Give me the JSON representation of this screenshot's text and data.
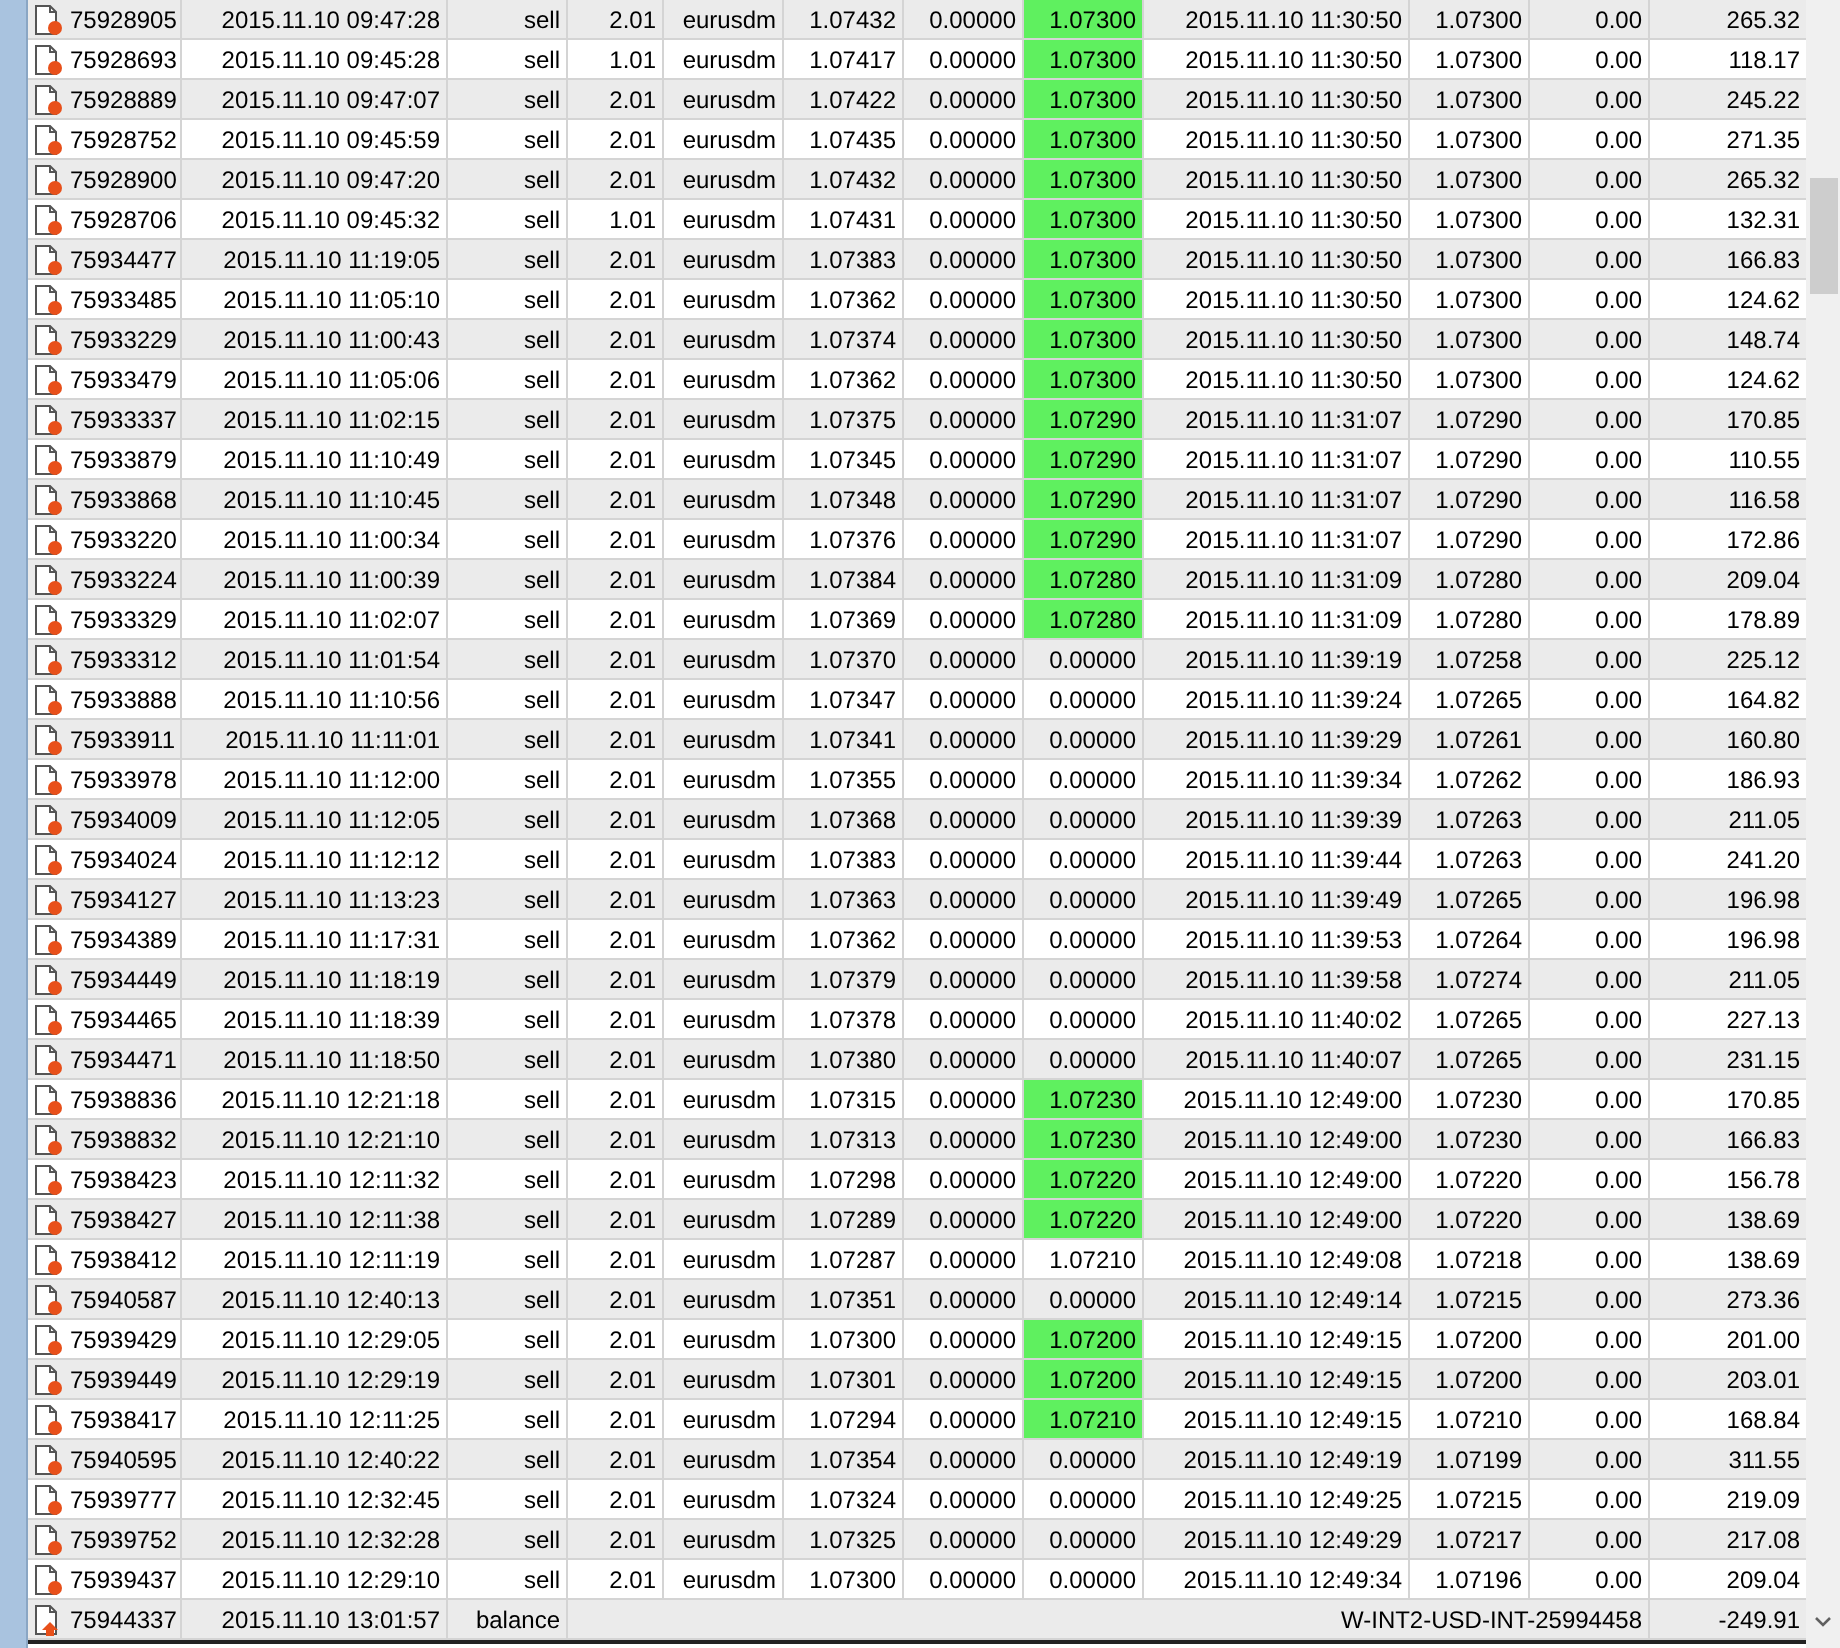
{
  "rows": [
    {
      "ticket": "75928905",
      "open_time": "2015.11.10 09:47:28",
      "type": "sell",
      "size": "2.01",
      "symbol": "eurusdm",
      "price": "1.07432",
      "sl": "0.00000",
      "tp": "1.07300",
      "tp_highlighted": true,
      "close_time": "2015.11.10 11:30:50",
      "close_price": "1.07300",
      "swap": "0.00",
      "profit": "265.32"
    },
    {
      "ticket": "75928693",
      "open_time": "2015.11.10 09:45:28",
      "type": "sell",
      "size": "1.01",
      "symbol": "eurusdm",
      "price": "1.07417",
      "sl": "0.00000",
      "tp": "1.07300",
      "tp_highlighted": true,
      "close_time": "2015.11.10 11:30:50",
      "close_price": "1.07300",
      "swap": "0.00",
      "profit": "118.17"
    },
    {
      "ticket": "75928889",
      "open_time": "2015.11.10 09:47:07",
      "type": "sell",
      "size": "2.01",
      "symbol": "eurusdm",
      "price": "1.07422",
      "sl": "0.00000",
      "tp": "1.07300",
      "tp_highlighted": true,
      "close_time": "2015.11.10 11:30:50",
      "close_price": "1.07300",
      "swap": "0.00",
      "profit": "245.22"
    },
    {
      "ticket": "75928752",
      "open_time": "2015.11.10 09:45:59",
      "type": "sell",
      "size": "2.01",
      "symbol": "eurusdm",
      "price": "1.07435",
      "sl": "0.00000",
      "tp": "1.07300",
      "tp_highlighted": true,
      "close_time": "2015.11.10 11:30:50",
      "close_price": "1.07300",
      "swap": "0.00",
      "profit": "271.35"
    },
    {
      "ticket": "75928900",
      "open_time": "2015.11.10 09:47:20",
      "type": "sell",
      "size": "2.01",
      "symbol": "eurusdm",
      "price": "1.07432",
      "sl": "0.00000",
      "tp": "1.07300",
      "tp_highlighted": true,
      "close_time": "2015.11.10 11:30:50",
      "close_price": "1.07300",
      "swap": "0.00",
      "profit": "265.32"
    },
    {
      "ticket": "75928706",
      "open_time": "2015.11.10 09:45:32",
      "type": "sell",
      "size": "1.01",
      "symbol": "eurusdm",
      "price": "1.07431",
      "sl": "0.00000",
      "tp": "1.07300",
      "tp_highlighted": true,
      "close_time": "2015.11.10 11:30:50",
      "close_price": "1.07300",
      "swap": "0.00",
      "profit": "132.31"
    },
    {
      "ticket": "75934477",
      "open_time": "2015.11.10 11:19:05",
      "type": "sell",
      "size": "2.01",
      "symbol": "eurusdm",
      "price": "1.07383",
      "sl": "0.00000",
      "tp": "1.07300",
      "tp_highlighted": true,
      "close_time": "2015.11.10 11:30:50",
      "close_price": "1.07300",
      "swap": "0.00",
      "profit": "166.83"
    },
    {
      "ticket": "75933485",
      "open_time": "2015.11.10 11:05:10",
      "type": "sell",
      "size": "2.01",
      "symbol": "eurusdm",
      "price": "1.07362",
      "sl": "0.00000",
      "tp": "1.07300",
      "tp_highlighted": true,
      "close_time": "2015.11.10 11:30:50",
      "close_price": "1.07300",
      "swap": "0.00",
      "profit": "124.62"
    },
    {
      "ticket": "75933229",
      "open_time": "2015.11.10 11:00:43",
      "type": "sell",
      "size": "2.01",
      "symbol": "eurusdm",
      "price": "1.07374",
      "sl": "0.00000",
      "tp": "1.07300",
      "tp_highlighted": true,
      "close_time": "2015.11.10 11:30:50",
      "close_price": "1.07300",
      "swap": "0.00",
      "profit": "148.74"
    },
    {
      "ticket": "75933479",
      "open_time": "2015.11.10 11:05:06",
      "type": "sell",
      "size": "2.01",
      "symbol": "eurusdm",
      "price": "1.07362",
      "sl": "0.00000",
      "tp": "1.07300",
      "tp_highlighted": true,
      "close_time": "2015.11.10 11:30:50",
      "close_price": "1.07300",
      "swap": "0.00",
      "profit": "124.62"
    },
    {
      "ticket": "75933337",
      "open_time": "2015.11.10 11:02:15",
      "type": "sell",
      "size": "2.01",
      "symbol": "eurusdm",
      "price": "1.07375",
      "sl": "0.00000",
      "tp": "1.07290",
      "tp_highlighted": true,
      "close_time": "2015.11.10 11:31:07",
      "close_price": "1.07290",
      "swap": "0.00",
      "profit": "170.85"
    },
    {
      "ticket": "75933879",
      "open_time": "2015.11.10 11:10:49",
      "type": "sell",
      "size": "2.01",
      "symbol": "eurusdm",
      "price": "1.07345",
      "sl": "0.00000",
      "tp": "1.07290",
      "tp_highlighted": true,
      "close_time": "2015.11.10 11:31:07",
      "close_price": "1.07290",
      "swap": "0.00",
      "profit": "110.55"
    },
    {
      "ticket": "75933868",
      "open_time": "2015.11.10 11:10:45",
      "type": "sell",
      "size": "2.01",
      "symbol": "eurusdm",
      "price": "1.07348",
      "sl": "0.00000",
      "tp": "1.07290",
      "tp_highlighted": true,
      "close_time": "2015.11.10 11:31:07",
      "close_price": "1.07290",
      "swap": "0.00",
      "profit": "116.58"
    },
    {
      "ticket": "75933220",
      "open_time": "2015.11.10 11:00:34",
      "type": "sell",
      "size": "2.01",
      "symbol": "eurusdm",
      "price": "1.07376",
      "sl": "0.00000",
      "tp": "1.07290",
      "tp_highlighted": true,
      "close_time": "2015.11.10 11:31:07",
      "close_price": "1.07290",
      "swap": "0.00",
      "profit": "172.86"
    },
    {
      "ticket": "75933224",
      "open_time": "2015.11.10 11:00:39",
      "type": "sell",
      "size": "2.01",
      "symbol": "eurusdm",
      "price": "1.07384",
      "sl": "0.00000",
      "tp": "1.07280",
      "tp_highlighted": true,
      "close_time": "2015.11.10 11:31:09",
      "close_price": "1.07280",
      "swap": "0.00",
      "profit": "209.04"
    },
    {
      "ticket": "75933329",
      "open_time": "2015.11.10 11:02:07",
      "type": "sell",
      "size": "2.01",
      "symbol": "eurusdm",
      "price": "1.07369",
      "sl": "0.00000",
      "tp": "1.07280",
      "tp_highlighted": true,
      "close_time": "2015.11.10 11:31:09",
      "close_price": "1.07280",
      "swap": "0.00",
      "profit": "178.89"
    },
    {
      "ticket": "75933312",
      "open_time": "2015.11.10 11:01:54",
      "type": "sell",
      "size": "2.01",
      "symbol": "eurusdm",
      "price": "1.07370",
      "sl": "0.00000",
      "tp": "0.00000",
      "tp_highlighted": false,
      "close_time": "2015.11.10 11:39:19",
      "close_price": "1.07258",
      "swap": "0.00",
      "profit": "225.12"
    },
    {
      "ticket": "75933888",
      "open_time": "2015.11.10 11:10:56",
      "type": "sell",
      "size": "2.01",
      "symbol": "eurusdm",
      "price": "1.07347",
      "sl": "0.00000",
      "tp": "0.00000",
      "tp_highlighted": false,
      "close_time": "2015.11.10 11:39:24",
      "close_price": "1.07265",
      "swap": "0.00",
      "profit": "164.82"
    },
    {
      "ticket": "75933911",
      "open_time": "2015.11.10 11:11:01",
      "type": "sell",
      "size": "2.01",
      "symbol": "eurusdm",
      "price": "1.07341",
      "sl": "0.00000",
      "tp": "0.00000",
      "tp_highlighted": false,
      "close_time": "2015.11.10 11:39:29",
      "close_price": "1.07261",
      "swap": "0.00",
      "profit": "160.80"
    },
    {
      "ticket": "75933978",
      "open_time": "2015.11.10 11:12:00",
      "type": "sell",
      "size": "2.01",
      "symbol": "eurusdm",
      "price": "1.07355",
      "sl": "0.00000",
      "tp": "0.00000",
      "tp_highlighted": false,
      "close_time": "2015.11.10 11:39:34",
      "close_price": "1.07262",
      "swap": "0.00",
      "profit": "186.93"
    },
    {
      "ticket": "75934009",
      "open_time": "2015.11.10 11:12:05",
      "type": "sell",
      "size": "2.01",
      "symbol": "eurusdm",
      "price": "1.07368",
      "sl": "0.00000",
      "tp": "0.00000",
      "tp_highlighted": false,
      "close_time": "2015.11.10 11:39:39",
      "close_price": "1.07263",
      "swap": "0.00",
      "profit": "211.05"
    },
    {
      "ticket": "75934024",
      "open_time": "2015.11.10 11:12:12",
      "type": "sell",
      "size": "2.01",
      "symbol": "eurusdm",
      "price": "1.07383",
      "sl": "0.00000",
      "tp": "0.00000",
      "tp_highlighted": false,
      "close_time": "2015.11.10 11:39:44",
      "close_price": "1.07263",
      "swap": "0.00",
      "profit": "241.20"
    },
    {
      "ticket": "75934127",
      "open_time": "2015.11.10 11:13:23",
      "type": "sell",
      "size": "2.01",
      "symbol": "eurusdm",
      "price": "1.07363",
      "sl": "0.00000",
      "tp": "0.00000",
      "tp_highlighted": false,
      "close_time": "2015.11.10 11:39:49",
      "close_price": "1.07265",
      "swap": "0.00",
      "profit": "196.98"
    },
    {
      "ticket": "75934389",
      "open_time": "2015.11.10 11:17:31",
      "type": "sell",
      "size": "2.01",
      "symbol": "eurusdm",
      "price": "1.07362",
      "sl": "0.00000",
      "tp": "0.00000",
      "tp_highlighted": false,
      "close_time": "2015.11.10 11:39:53",
      "close_price": "1.07264",
      "swap": "0.00",
      "profit": "196.98"
    },
    {
      "ticket": "75934449",
      "open_time": "2015.11.10 11:18:19",
      "type": "sell",
      "size": "2.01",
      "symbol": "eurusdm",
      "price": "1.07379",
      "sl": "0.00000",
      "tp": "0.00000",
      "tp_highlighted": false,
      "close_time": "2015.11.10 11:39:58",
      "close_price": "1.07274",
      "swap": "0.00",
      "profit": "211.05"
    },
    {
      "ticket": "75934465",
      "open_time": "2015.11.10 11:18:39",
      "type": "sell",
      "size": "2.01",
      "symbol": "eurusdm",
      "price": "1.07378",
      "sl": "0.00000",
      "tp": "0.00000",
      "tp_highlighted": false,
      "close_time": "2015.11.10 11:40:02",
      "close_price": "1.07265",
      "swap": "0.00",
      "profit": "227.13"
    },
    {
      "ticket": "75934471",
      "open_time": "2015.11.10 11:18:50",
      "type": "sell",
      "size": "2.01",
      "symbol": "eurusdm",
      "price": "1.07380",
      "sl": "0.00000",
      "tp": "0.00000",
      "tp_highlighted": false,
      "close_time": "2015.11.10 11:40:07",
      "close_price": "1.07265",
      "swap": "0.00",
      "profit": "231.15"
    },
    {
      "ticket": "75938836",
      "open_time": "2015.11.10 12:21:18",
      "type": "sell",
      "size": "2.01",
      "symbol": "eurusdm",
      "price": "1.07315",
      "sl": "0.00000",
      "tp": "1.07230",
      "tp_highlighted": true,
      "close_time": "2015.11.10 12:49:00",
      "close_price": "1.07230",
      "swap": "0.00",
      "profit": "170.85"
    },
    {
      "ticket": "75938832",
      "open_time": "2015.11.10 12:21:10",
      "type": "sell",
      "size": "2.01",
      "symbol": "eurusdm",
      "price": "1.07313",
      "sl": "0.00000",
      "tp": "1.07230",
      "tp_highlighted": true,
      "close_time": "2015.11.10 12:49:00",
      "close_price": "1.07230",
      "swap": "0.00",
      "profit": "166.83"
    },
    {
      "ticket": "75938423",
      "open_time": "2015.11.10 12:11:32",
      "type": "sell",
      "size": "2.01",
      "symbol": "eurusdm",
      "price": "1.07298",
      "sl": "0.00000",
      "tp": "1.07220",
      "tp_highlighted": true,
      "close_time": "2015.11.10 12:49:00",
      "close_price": "1.07220",
      "swap": "0.00",
      "profit": "156.78"
    },
    {
      "ticket": "75938427",
      "open_time": "2015.11.10 12:11:38",
      "type": "sell",
      "size": "2.01",
      "symbol": "eurusdm",
      "price": "1.07289",
      "sl": "0.00000",
      "tp": "1.07220",
      "tp_highlighted": true,
      "close_time": "2015.11.10 12:49:00",
      "close_price": "1.07220",
      "swap": "0.00",
      "profit": "138.69"
    },
    {
      "ticket": "75938412",
      "open_time": "2015.11.10 12:11:19",
      "type": "sell",
      "size": "2.01",
      "symbol": "eurusdm",
      "price": "1.07287",
      "sl": "0.00000",
      "tp": "1.07210",
      "tp_highlighted": false,
      "close_time": "2015.11.10 12:49:08",
      "close_price": "1.07218",
      "swap": "0.00",
      "profit": "138.69"
    },
    {
      "ticket": "75940587",
      "open_time": "2015.11.10 12:40:13",
      "type": "sell",
      "size": "2.01",
      "symbol": "eurusdm",
      "price": "1.07351",
      "sl": "0.00000",
      "tp": "0.00000",
      "tp_highlighted": false,
      "close_time": "2015.11.10 12:49:14",
      "close_price": "1.07215",
      "swap": "0.00",
      "profit": "273.36"
    },
    {
      "ticket": "75939429",
      "open_time": "2015.11.10 12:29:05",
      "type": "sell",
      "size": "2.01",
      "symbol": "eurusdm",
      "price": "1.07300",
      "sl": "0.00000",
      "tp": "1.07200",
      "tp_highlighted": true,
      "close_time": "2015.11.10 12:49:15",
      "close_price": "1.07200",
      "swap": "0.00",
      "profit": "201.00"
    },
    {
      "ticket": "75939449",
      "open_time": "2015.11.10 12:29:19",
      "type": "sell",
      "size": "2.01",
      "symbol": "eurusdm",
      "price": "1.07301",
      "sl": "0.00000",
      "tp": "1.07200",
      "tp_highlighted": true,
      "close_time": "2015.11.10 12:49:15",
      "close_price": "1.07200",
      "swap": "0.00",
      "profit": "203.01"
    },
    {
      "ticket": "75938417",
      "open_time": "2015.11.10 12:11:25",
      "type": "sell",
      "size": "2.01",
      "symbol": "eurusdm",
      "price": "1.07294",
      "sl": "0.00000",
      "tp": "1.07210",
      "tp_highlighted": true,
      "close_time": "2015.11.10 12:49:15",
      "close_price": "1.07210",
      "swap": "0.00",
      "profit": "168.84"
    },
    {
      "ticket": "75940595",
      "open_time": "2015.11.10 12:40:22",
      "type": "sell",
      "size": "2.01",
      "symbol": "eurusdm",
      "price": "1.07354",
      "sl": "0.00000",
      "tp": "0.00000",
      "tp_highlighted": false,
      "close_time": "2015.11.10 12:49:19",
      "close_price": "1.07199",
      "swap": "0.00",
      "profit": "311.55"
    },
    {
      "ticket": "75939777",
      "open_time": "2015.11.10 12:32:45",
      "type": "sell",
      "size": "2.01",
      "symbol": "eurusdm",
      "price": "1.07324",
      "sl": "0.00000",
      "tp": "0.00000",
      "tp_highlighted": false,
      "close_time": "2015.11.10 12:49:25",
      "close_price": "1.07215",
      "swap": "0.00",
      "profit": "219.09"
    },
    {
      "ticket": "75939752",
      "open_time": "2015.11.10 12:32:28",
      "type": "sell",
      "size": "2.01",
      "symbol": "eurusdm",
      "price": "1.07325",
      "sl": "0.00000",
      "tp": "0.00000",
      "tp_highlighted": false,
      "close_time": "2015.11.10 12:49:29",
      "close_price": "1.07217",
      "swap": "0.00",
      "profit": "217.08"
    },
    {
      "ticket": "75939437",
      "open_time": "2015.11.10 12:29:10",
      "type": "sell",
      "size": "2.01",
      "symbol": "eurusdm",
      "price": "1.07300",
      "sl": "0.00000",
      "tp": "0.00000",
      "tp_highlighted": false,
      "close_time": "2015.11.10 12:49:34",
      "close_price": "1.07196",
      "swap": "0.00",
      "profit": "209.04"
    }
  ],
  "balance_row": {
    "ticket": "75944337",
    "time": "2015.11.10 13:01:57",
    "type": "balance",
    "comment": "W-INT2-USD-INT-25994458",
    "profit": "-249.91"
  }
}
